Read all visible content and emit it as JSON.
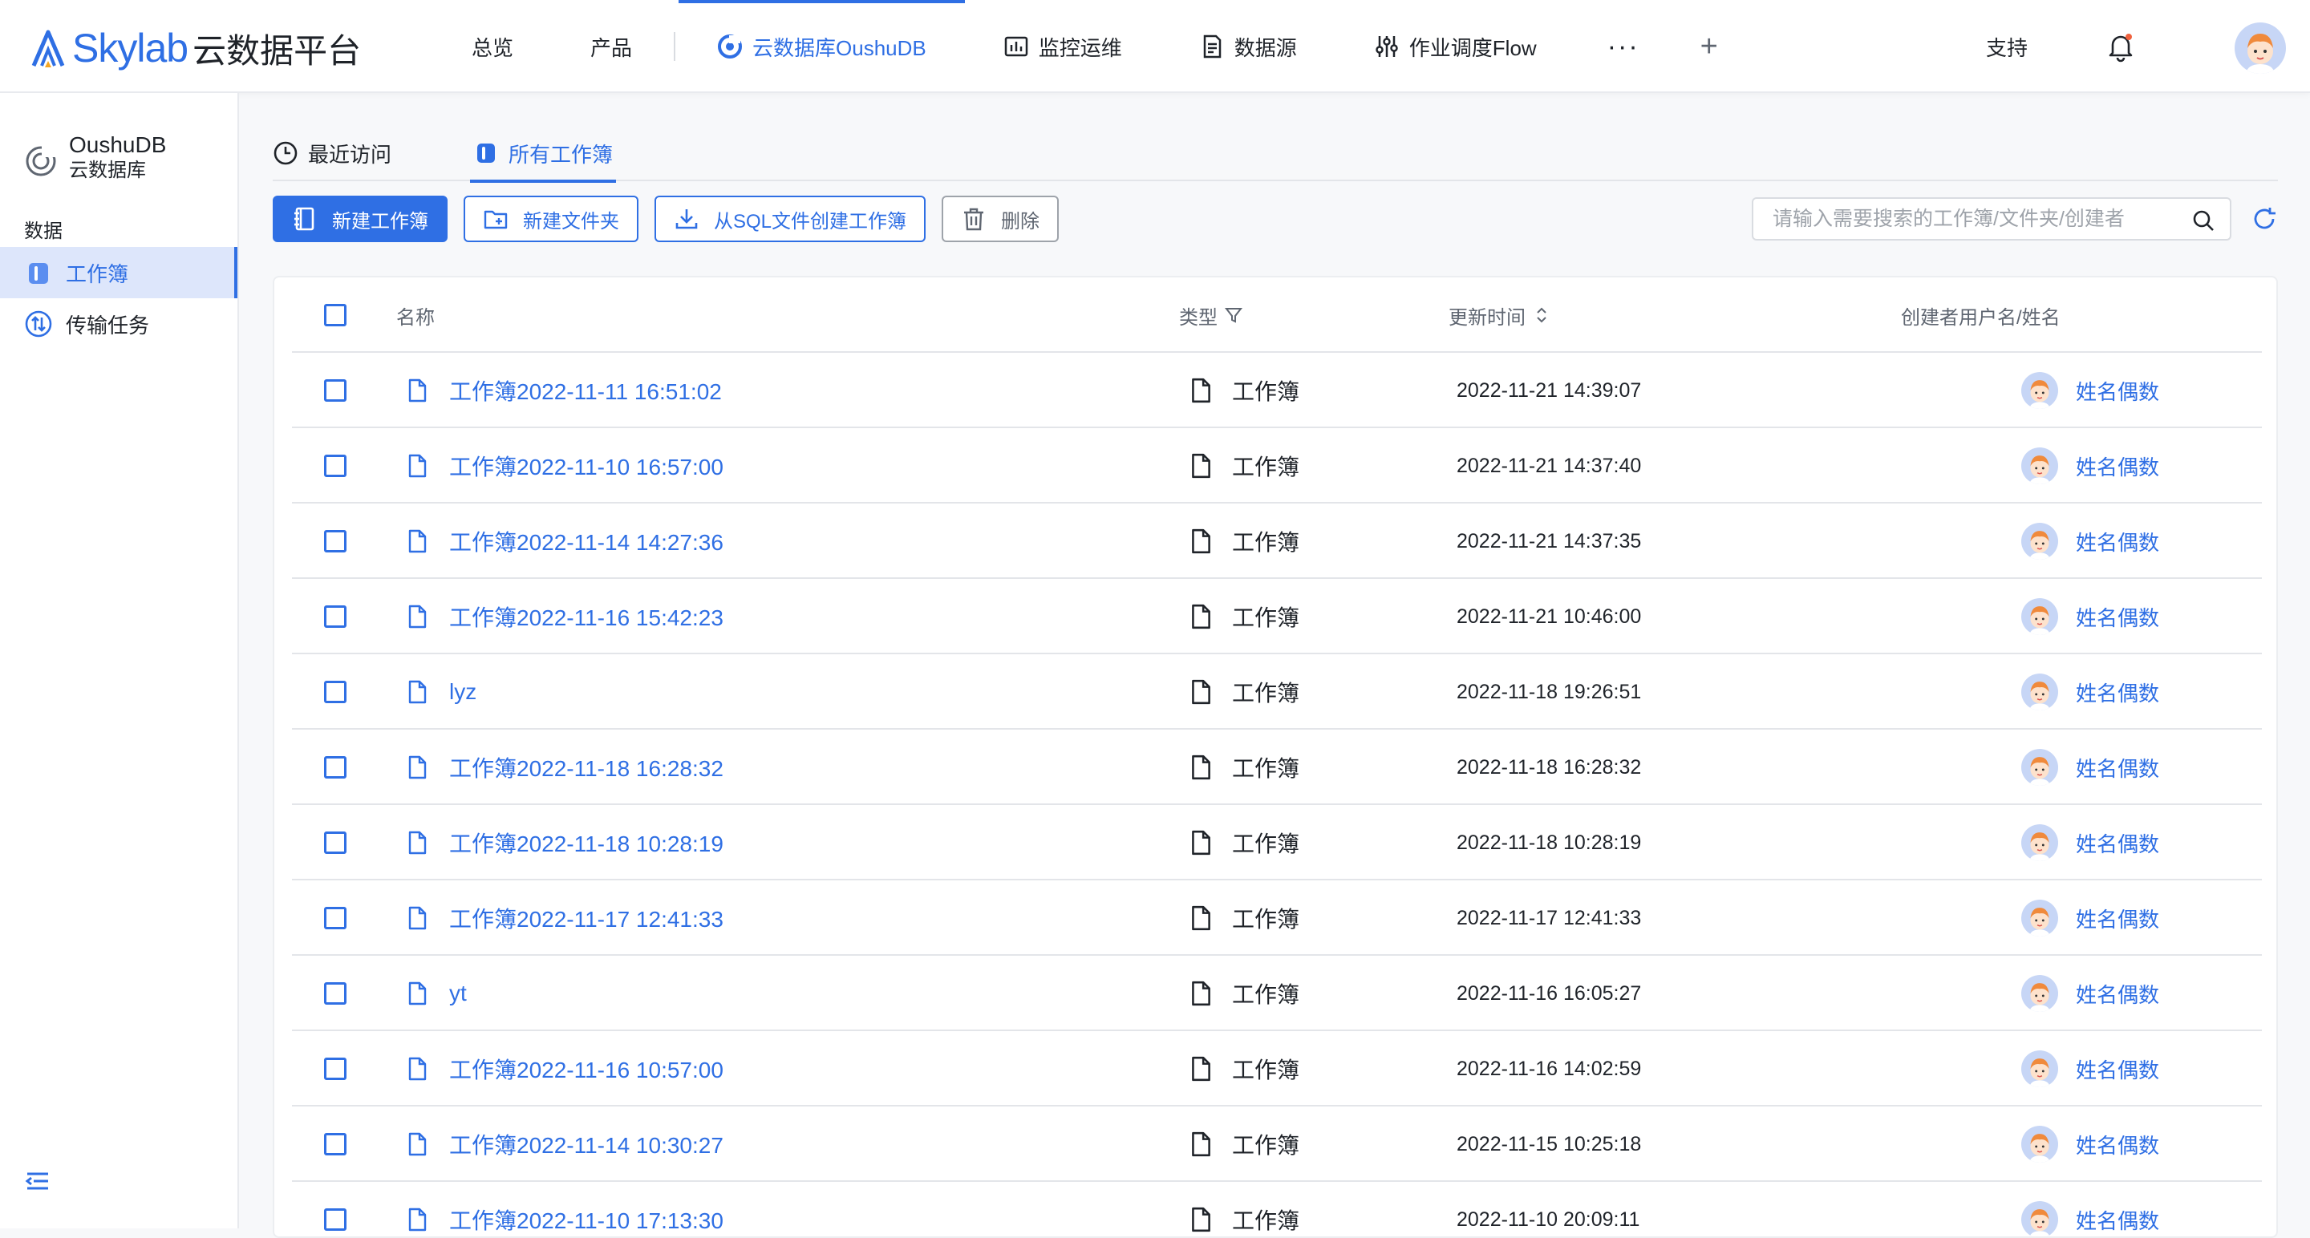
{
  "app": {
    "brand_name": "Skylab",
    "brand_sub": "云数据平台"
  },
  "nav": {
    "items": [
      {
        "label": "总览"
      },
      {
        "label": "产品"
      },
      {
        "label": "云数据库OushuDB",
        "active": true,
        "icon": "database-spiral-icon"
      },
      {
        "label": "监控运维",
        "icon": "monitor-chart-icon"
      },
      {
        "label": "数据源",
        "icon": "document-list-icon"
      },
      {
        "label": "作业调度Flow",
        "icon": "sliders-icon"
      }
    ],
    "more_label": "···",
    "add_label": "+",
    "support_label": "支持"
  },
  "sidebar": {
    "db_name": "OushuDB",
    "db_sub": "云数据库",
    "section_label": "数据",
    "items": [
      {
        "label": "工作簿",
        "active": true,
        "icon": "workbook-icon"
      },
      {
        "label": "传输任务",
        "icon": "transfer-icon"
      }
    ]
  },
  "tabs": [
    {
      "label": "最近访问",
      "icon": "clock-icon"
    },
    {
      "label": "所有工作簿",
      "active": true,
      "icon": "workbook-icon"
    }
  ],
  "toolbar": {
    "new_workbook": "新建工作簿",
    "new_folder": "新建文件夹",
    "from_sql": "从SQL文件创建工作簿",
    "delete": "删除"
  },
  "search": {
    "placeholder": "请输入需要搜索的工作簿/文件夹/创建者"
  },
  "table": {
    "headers": {
      "name": "名称",
      "type": "类型",
      "updated": "更新时间",
      "creator": "创建者用户名/姓名"
    },
    "rows": [
      {
        "name": "工作簿2022-11-11 16:51:02",
        "type": "工作簿",
        "updated": "2022-11-21 14:39:07",
        "creator": "姓名偶数"
      },
      {
        "name": "工作簿2022-11-10 16:57:00",
        "type": "工作簿",
        "updated": "2022-11-21 14:37:40",
        "creator": "姓名偶数"
      },
      {
        "name": "工作簿2022-11-14 14:27:36",
        "type": "工作簿",
        "updated": "2022-11-21 14:37:35",
        "creator": "姓名偶数"
      },
      {
        "name": "工作簿2022-11-16 15:42:23",
        "type": "工作簿",
        "updated": "2022-11-21 10:46:00",
        "creator": "姓名偶数"
      },
      {
        "name": "lyz",
        "type": "工作簿",
        "updated": "2022-11-18 19:26:51",
        "creator": "姓名偶数"
      },
      {
        "name": "工作簿2022-11-18 16:28:32",
        "type": "工作簿",
        "updated": "2022-11-18 16:28:32",
        "creator": "姓名偶数"
      },
      {
        "name": "工作簿2022-11-18 10:28:19",
        "type": "工作簿",
        "updated": "2022-11-18 10:28:19",
        "creator": "姓名偶数"
      },
      {
        "name": "工作簿2022-11-17 12:41:33",
        "type": "工作簿",
        "updated": "2022-11-17 12:41:33",
        "creator": "姓名偶数"
      },
      {
        "name": "yt",
        "type": "工作簿",
        "updated": "2022-11-16 16:05:27",
        "creator": "姓名偶数"
      },
      {
        "name": "工作簿2022-11-16 10:57:00",
        "type": "工作簿",
        "updated": "2022-11-16 14:02:59",
        "creator": "姓名偶数"
      },
      {
        "name": "工作簿2022-11-14 10:30:27",
        "type": "工作簿",
        "updated": "2022-11-15 10:25:18",
        "creator": "姓名偶数"
      },
      {
        "name": "工作簿2022-11-10 17:13:30",
        "type": "工作簿",
        "updated": "2022-11-10 20:09:11",
        "creator": "姓名偶数"
      }
    ]
  },
  "colors": {
    "accent": "#2f6fe4",
    "text": "#1f2329",
    "muted": "#5f6671",
    "active_bg": "#dde6fb"
  }
}
